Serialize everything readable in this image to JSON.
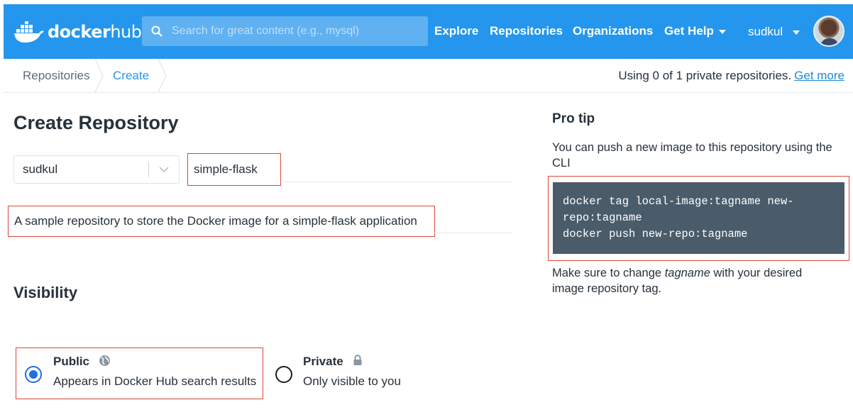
{
  "header": {
    "logo_text_part1": "docker",
    "logo_text_part2": "hub",
    "search_placeholder": "Search for great content (e.g., mysql)",
    "nav": {
      "explore": "Explore",
      "repositories": "Repositories",
      "organizations": "Organizations",
      "get_help": "Get Help"
    },
    "username": "sudkul",
    "brand_color": "#2496ed"
  },
  "breadcrumb": {
    "items": [
      "Repositories",
      "Create"
    ],
    "usage_text": "Using 0 of 1 private repositories.",
    "usage_link": "Get more"
  },
  "form": {
    "title": "Create Repository",
    "namespace": "sudkul",
    "repo_name": "simple-flask",
    "description": "A sample repository to store the Docker image for a simple-flask application",
    "visibility_title": "Visibility",
    "options": [
      {
        "title": "Public",
        "subtitle": "Appears in Docker Hub search results",
        "selected": true,
        "icon": "globe-icon"
      },
      {
        "title": "Private",
        "subtitle": "Only visible to you",
        "selected": false,
        "icon": "lock-icon"
      }
    ]
  },
  "pro_tip": {
    "heading": "Pro tip",
    "intro": "You can push a new image to this repository using the CLI",
    "code": "docker tag local-image:tagname new-\nrepo:tagname\ndocker push new-repo:tagname",
    "note_before": "Make sure to change ",
    "note_emph": "tagname",
    "note_after": " with your desired image repository tag."
  },
  "colors": {
    "highlight_border": "#d9493a",
    "link": "#1e8bd9",
    "radio_selected": "#1e6fe0",
    "code_bg": "#4a5c6a"
  }
}
